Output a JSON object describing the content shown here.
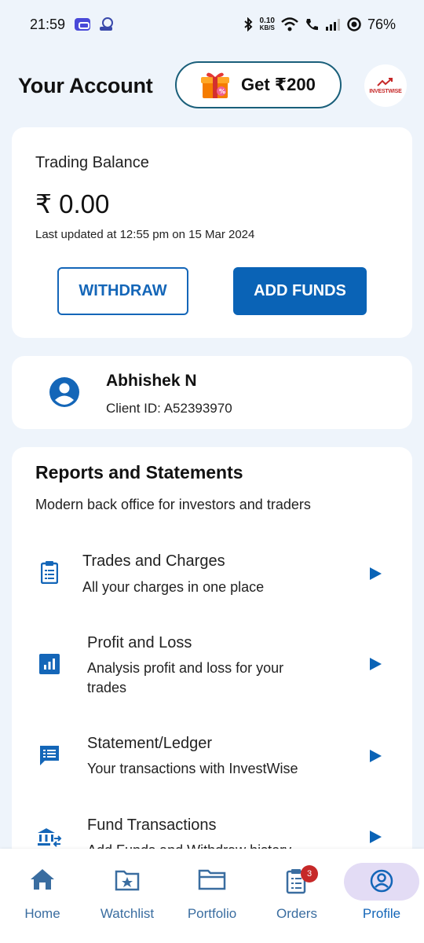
{
  "status_bar": {
    "time": "21:59",
    "speed_value": "0.10",
    "speed_unit": "KB/S",
    "battery": "76%"
  },
  "header": {
    "title": "Your Account",
    "refer_label": "Get ₹200",
    "logo_text": "INVESTWISE"
  },
  "balance": {
    "label": "Trading Balance",
    "amount": "₹ 0.00",
    "updated": "Last updated at 12:55 pm on 15 Mar 2024",
    "withdraw_label": "WITHDRAW",
    "add_funds_label": "ADD FUNDS"
  },
  "profile": {
    "name": "Abhishek N",
    "client_id": "Client ID: A52393970"
  },
  "reports": {
    "title": "Reports and Statements",
    "subtitle": "Modern back office for investors and traders",
    "items": [
      {
        "title": "Trades and Charges",
        "desc": "All your charges in one place",
        "icon": "clipboard-icon"
      },
      {
        "title": "Profit and Loss",
        "desc": "Analysis profit and loss for your trades",
        "icon": "bar-chart-icon"
      },
      {
        "title": "Statement/Ledger",
        "desc": "Your transactions with InvestWise",
        "icon": "message-list-icon"
      },
      {
        "title": "Fund Transactions",
        "desc": "Add Funds and Withdraw history",
        "icon": "bank-transfer-icon"
      }
    ]
  },
  "nav": {
    "items": [
      {
        "label": "Home",
        "icon": "home-icon"
      },
      {
        "label": "Watchlist",
        "icon": "watchlist-icon"
      },
      {
        "label": "Portfolio",
        "icon": "folder-icon"
      },
      {
        "label": "Orders",
        "icon": "orders-icon"
      },
      {
        "label": "Profile",
        "icon": "profile-icon"
      }
    ],
    "orders_badge": "3",
    "active": "Profile"
  },
  "colors": {
    "accent": "#0a63b6",
    "background": "#eef4fb",
    "badge": "#c62828",
    "active_pill": "#e3dcf5"
  }
}
